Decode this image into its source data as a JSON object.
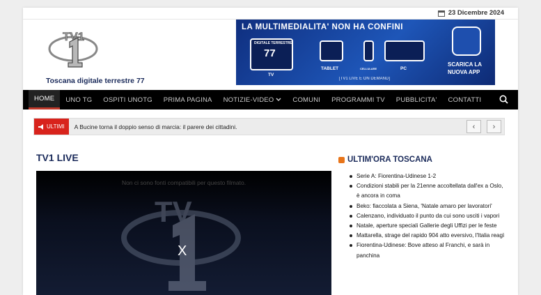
{
  "topbar": {
    "date": "23 Dicembre 2024"
  },
  "header": {
    "logo_text": "TV1",
    "tagline": "Toscana digitale terrestre 77",
    "banner": {
      "headline": "LA MULTIMEDIALITA' NON HA CONFINI",
      "dtt_label": "DIGITALE TERRESTRE",
      "channel": "77",
      "tv_label": "TV",
      "tablet_label": "TABLET",
      "phone_label": "CELLULARE",
      "pc_label": "PC",
      "sub": "[TV1 LIVE E ON DEMAND]",
      "app_cta_1": "SCARICA LA",
      "app_cta_2": "NUOVA APP"
    }
  },
  "nav": {
    "items": [
      {
        "label": "HOME",
        "active": true
      },
      {
        "label": "UNO TG"
      },
      {
        "label": "OSPITI UNOTG"
      },
      {
        "label": "PRIMA PAGINA"
      },
      {
        "label": "NOTIZIE-VIDEO",
        "dropdown": true
      },
      {
        "label": "COMUNI"
      },
      {
        "label": "PROGRAMMI TV"
      },
      {
        "label": "PUBBLICITA'"
      },
      {
        "label": "CONTATTI"
      }
    ],
    "search_icon": "search-icon"
  },
  "ticker": {
    "label": "ULTIMI",
    "text": "A Bucine torna il doppio senso di marcia: il parere dei cittadini.",
    "prev_icon": "chevron-left-icon",
    "next_icon": "chevron-right-icon"
  },
  "main": {
    "title": "TV1 LIVE",
    "player_message": "Non ci sono fonti compatibili per questo filmato.",
    "close_symbol": "X"
  },
  "sidebar": {
    "title": "ULTIM'ORA TOSCANA",
    "news": [
      "Serie A: Fiorentina-Udinese 1-2",
      "Condizioni stabili per la 21enne accoltellata dall'ex a Oslo, è ancora in coma",
      "Beko: fiaccolata a Siena, 'Natale amaro per lavoratori'",
      "Calenzano, individuato il punto da cui sono usciti i vapori",
      "Natale, aperture speciali Gallerie degli Uffizi per le feste",
      "Mattarella, strage del rapido 904 atto eversivo, l'Italia reagì",
      "Fiorentina-Udinese: Bove atteso al Franchi, e sarà in panchina"
    ]
  },
  "colors": {
    "accent": "#d8231c",
    "nav_bg": "#000000",
    "title": "#1a2a5a",
    "banner": "#1a4aa8"
  }
}
